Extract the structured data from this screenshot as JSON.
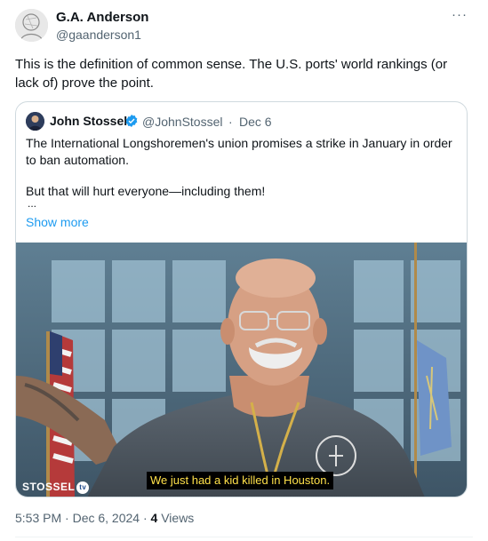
{
  "author": {
    "name": "G.A. Anderson",
    "handle": "@gaanderson1",
    "avatar_icon": "avatar-sketch"
  },
  "more_icon": "more-horizontal-icon",
  "more_label": "···",
  "tweet": {
    "text": "This is the definition of common sense. The U.S. ports' world rankings (or lack of) prove the point."
  },
  "quote": {
    "name": "John Stossel",
    "handle": "@JohnStossel",
    "separator": "·",
    "date": "Dec 6",
    "lines": [
      "The International Longshoremen's union promises a strike in January in order",
      "to ban automation.",
      "But that will hurt everyone—including them!"
    ],
    "ellipsis": "...",
    "show_more": "Show more",
    "media": {
      "subtitle": "We just had a kid killed in Houston.",
      "watermark": "STOSSEL",
      "watermark_badge": "tv"
    }
  },
  "meta": {
    "time_date": "5:53 PM · Dec 6, 2024 · ",
    "views_count": "4",
    "views_label": " Views"
  },
  "colors": {
    "link": "#1d9bf0",
    "secondary_text": "#536471",
    "primary_text": "#0f1419",
    "border": "#cfd9de",
    "subtitle_text": "#ffe14a"
  }
}
